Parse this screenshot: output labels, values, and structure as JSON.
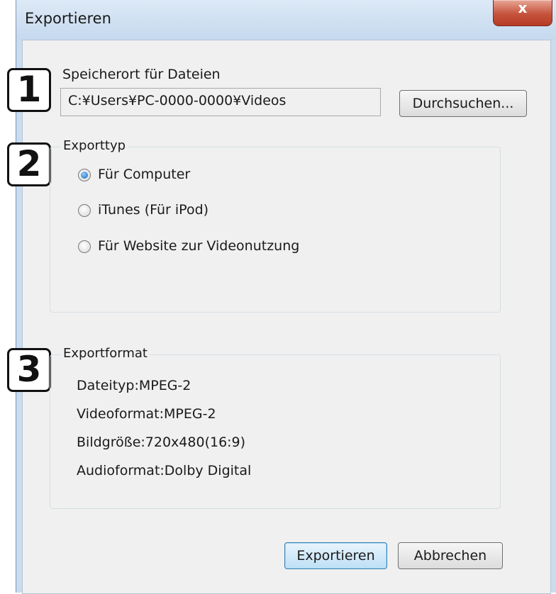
{
  "window": {
    "title": "Exportieren",
    "close_glyph": "x"
  },
  "badges": [
    "1",
    "2",
    "3"
  ],
  "storage": {
    "label": "Speicherort für Dateien",
    "path_value": "C:¥Users¥PC-0000-0000¥Videos",
    "browse_label": "Durchsuchen..."
  },
  "export_type": {
    "title": "Exporttyp",
    "options": [
      {
        "label": "Für Computer",
        "checked": true
      },
      {
        "label": "iTunes (Für iPod)",
        "checked": false
      },
      {
        "label": "Für Website zur Videonutzung",
        "checked": false
      }
    ]
  },
  "export_format": {
    "title": "Exportformat",
    "lines": [
      "Dateityp:MPEG-2",
      "Videoformat:MPEG-2",
      "Bildgröße:720x480(16:9)",
      "Audioformat:Dolby Digital"
    ]
  },
  "buttons": {
    "export_label": "Exportieren",
    "cancel_label": "Abbrechen"
  }
}
